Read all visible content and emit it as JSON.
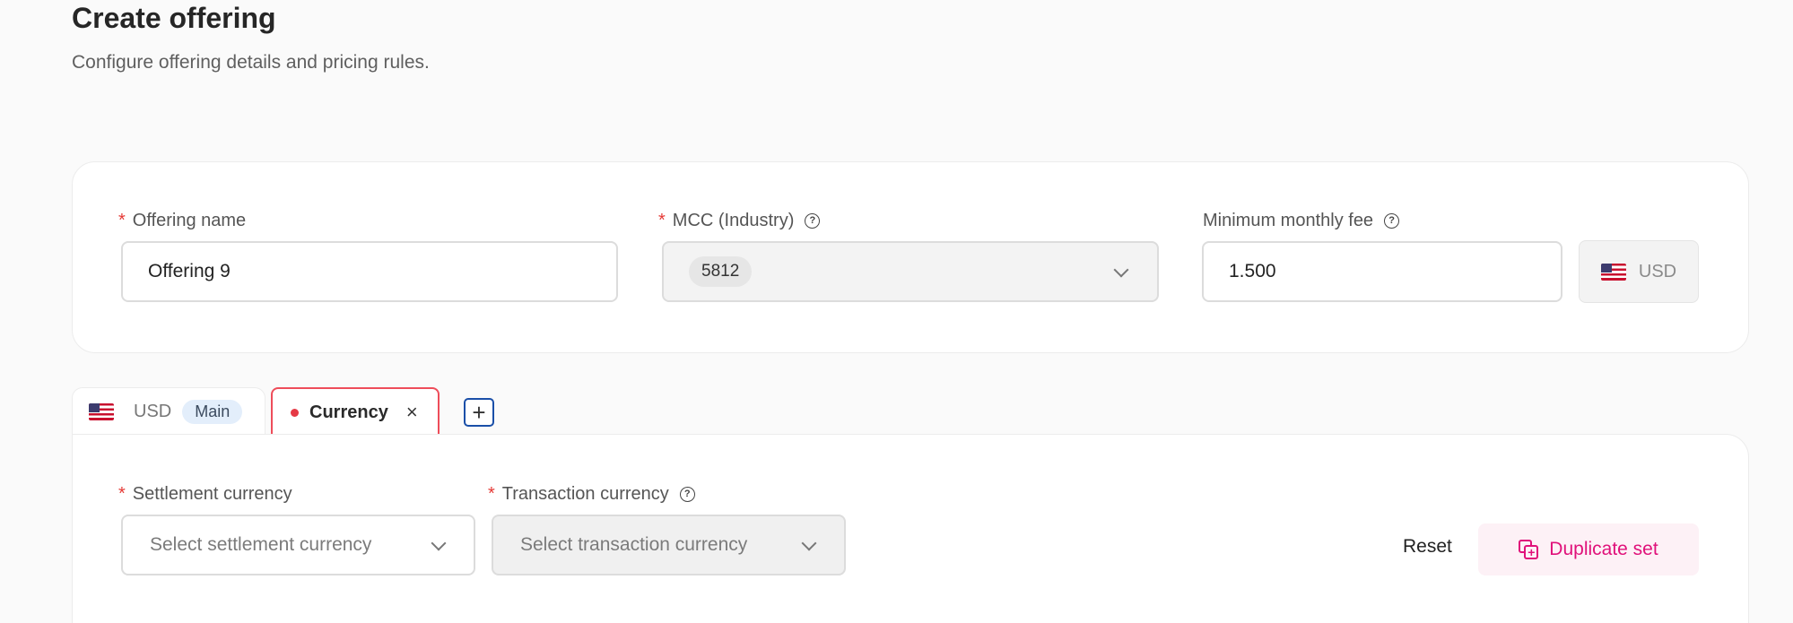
{
  "header": {
    "title": "Create offering",
    "subtitle": "Configure offering details and pricing rules."
  },
  "offering_card": {
    "offering_name": {
      "label": "Offering name",
      "value": "Offering 9",
      "required": true
    },
    "mcc": {
      "label": "MCC (Industry)",
      "value": "5812",
      "required": true
    },
    "min_fee": {
      "label": "Minimum monthly fee",
      "value": "1.500",
      "currency": "USD"
    }
  },
  "tabs": {
    "main": {
      "currency": "USD",
      "badge": "Main"
    },
    "active": {
      "label": "Currency",
      "close": "×"
    },
    "add": "+"
  },
  "currency_set": {
    "settlement": {
      "label": "Settlement currency",
      "placeholder": "Select settlement currency",
      "required": true
    },
    "transaction": {
      "label": "Transaction currency",
      "placeholder": "Select transaction currency",
      "required": true
    }
  },
  "actions": {
    "reset": "Reset",
    "duplicate": "Duplicate set"
  },
  "colors": {
    "required": "#e53935",
    "accent_pink": "#e0117a",
    "active_tab_border": "#ee4d5a",
    "focus_blue": "#1a4fa8"
  },
  "icons": {
    "help": "question-circle-icon",
    "chevron": "chevron-down-icon",
    "flag": "us-flag-icon",
    "close": "close-icon",
    "add": "plus-icon",
    "duplicate": "duplicate-icon"
  }
}
